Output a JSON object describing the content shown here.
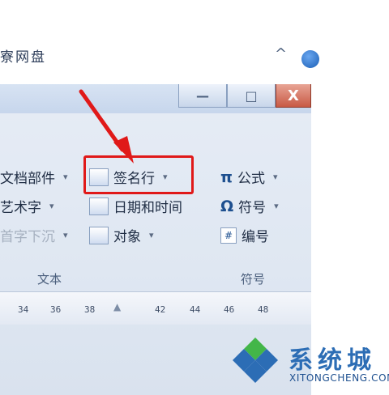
{
  "titlebar": {
    "min_glyph": "—",
    "max_glyph": "□",
    "close_glyph": "X"
  },
  "menu": {
    "tab_label": "寮网盘",
    "expand_glyph": "^"
  },
  "text_group": {
    "caption": "文本",
    "items": [
      {
        "label": "文档部件",
        "disabled": false,
        "dropdown": "▾"
      },
      {
        "label": "签名行",
        "disabled": false,
        "dropdown": "▾"
      },
      {
        "label": "艺术字",
        "disabled": false,
        "dropdown": "▾"
      },
      {
        "label": "日期和时间",
        "disabled": false
      },
      {
        "label": "首字下沉",
        "disabled": true,
        "dropdown": "▾"
      },
      {
        "label": "对象",
        "disabled": false,
        "dropdown": "▾"
      }
    ]
  },
  "symbol_group": {
    "caption": "符号",
    "items": [
      {
        "glyph": "π",
        "label": "公式",
        "dropdown": "▾"
      },
      {
        "glyph": "Ω",
        "label": "符号",
        "dropdown": "▾"
      },
      {
        "glyph": "#",
        "label": "编号"
      }
    ]
  },
  "ruler": {
    "ticks": [
      "34",
      "36",
      "38",
      "42",
      "44",
      "46",
      "48"
    ]
  },
  "watermark": {
    "title": "系统城",
    "subtitle": "XITONGCHENG.COM"
  },
  "colors": {
    "highlight": "#e01919",
    "arrow": "#e01919",
    "logo_blue": "#2c6db5",
    "logo_green": "#43b649"
  }
}
